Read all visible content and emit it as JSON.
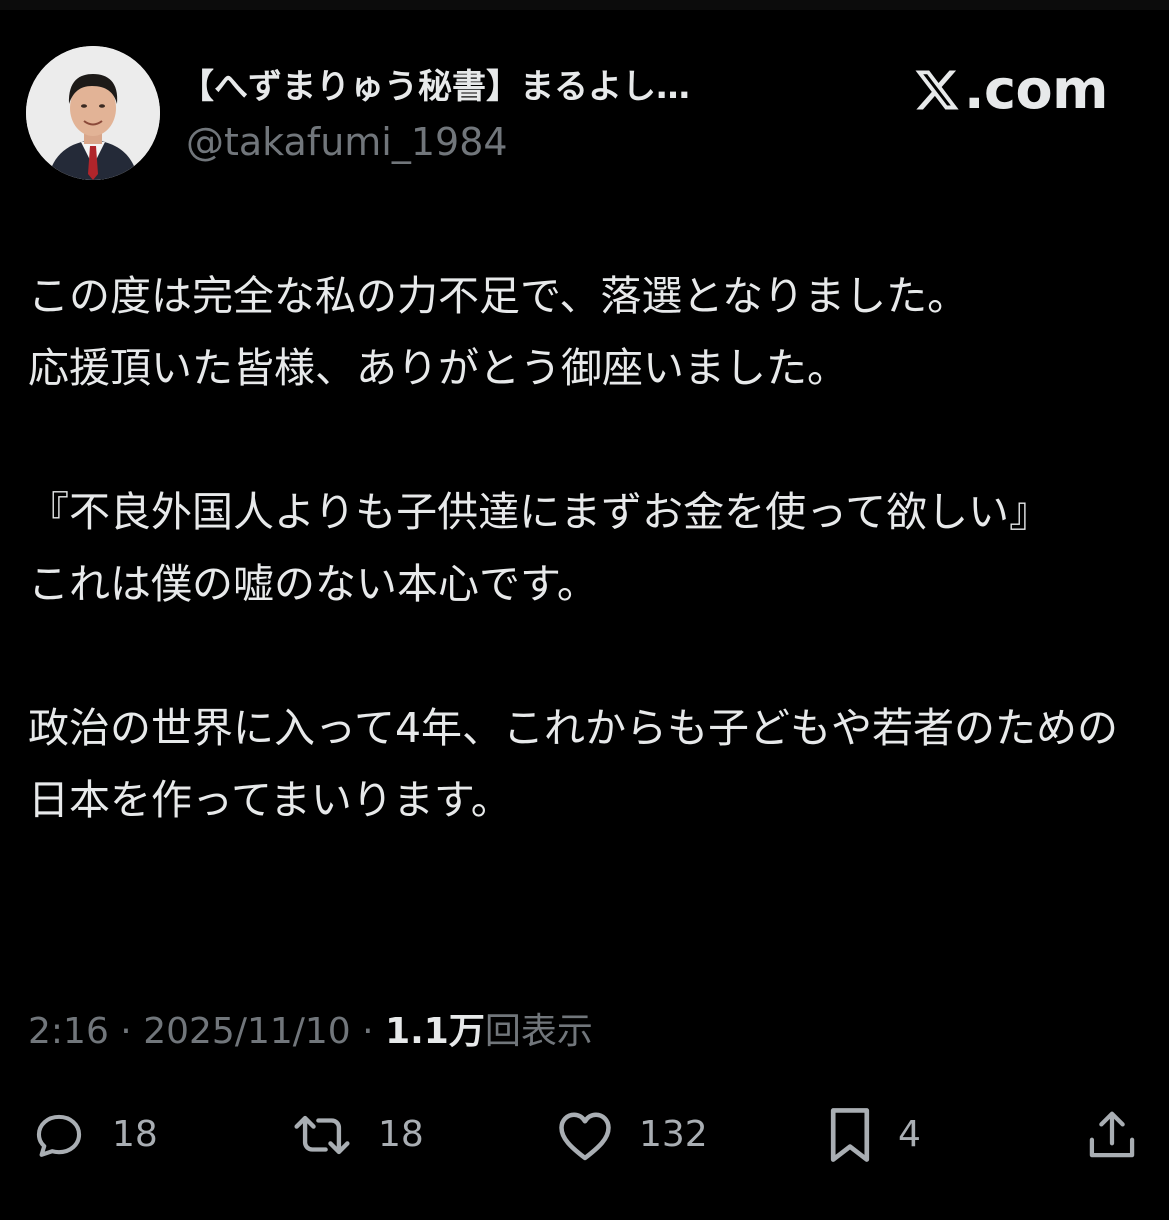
{
  "tweet": {
    "display_name": "【へずまりゅう秘書】まるよし…",
    "handle": "@takafumi_1984",
    "brand": ".com",
    "paragraphs": [
      "この度は完全な私の力不足で、落選となりました。\n応援頂いた皆様、ありがとう御座いました。",
      "『不良外国人よりも子供達にまずお金を使って欲しい』\nこれは僕の嘘のない本心です。",
      "政治の世界に入って4年、これからも子どもや若者のための日本を作ってまいります。"
    ],
    "time": "2:16",
    "separator": "·",
    "date": "2025/11/10",
    "views_count": "1.1万",
    "views_label": "回表示"
  },
  "actions": {
    "reply_count": "18",
    "repost_count": "18",
    "like_count": "132",
    "bookmark_count": "4"
  },
  "icons": [
    "x-logo-icon",
    "reply-icon",
    "repost-icon",
    "like-icon",
    "bookmark-icon",
    "share-icon"
  ],
  "colors": {
    "background": "#000000",
    "text": "#e7e9ea",
    "secondary_text": "#71767b",
    "icon": "#a9aeb3"
  }
}
